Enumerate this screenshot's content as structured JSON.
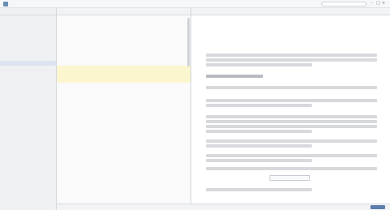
{
  "titlebar": {
    "app_title": "",
    "doc_title": "",
    "search_placeholder": ""
  },
  "sidebar": {
    "header": "",
    "items": [
      "",
      "",
      "",
      "",
      "",
      "",
      "",
      ""
    ],
    "group": "",
    "items2": [
      "",
      "",
      "",
      "",
      "",
      "",
      "",
      "",
      "",
      "",
      "",
      "",
      "",
      ""
    ]
  },
  "editor": {
    "header": "",
    "lines": [
      "",
      "",
      "",
      "",
      "",
      "",
      "",
      "",
      "",
      "",
      "",
      "",
      "",
      "",
      "",
      "",
      "",
      "",
      "",
      "",
      "",
      "",
      "",
      "",
      "",
      "",
      ""
    ],
    "status": ""
  },
  "preview": {
    "header": "",
    "sub": "",
    "title": "",
    "status": ""
  },
  "colors": {
    "accent": "#5d7fae",
    "link": "#6a7fa0",
    "highlight": "#fbf6cf",
    "sidebar_bg": "#eef0f3"
  }
}
